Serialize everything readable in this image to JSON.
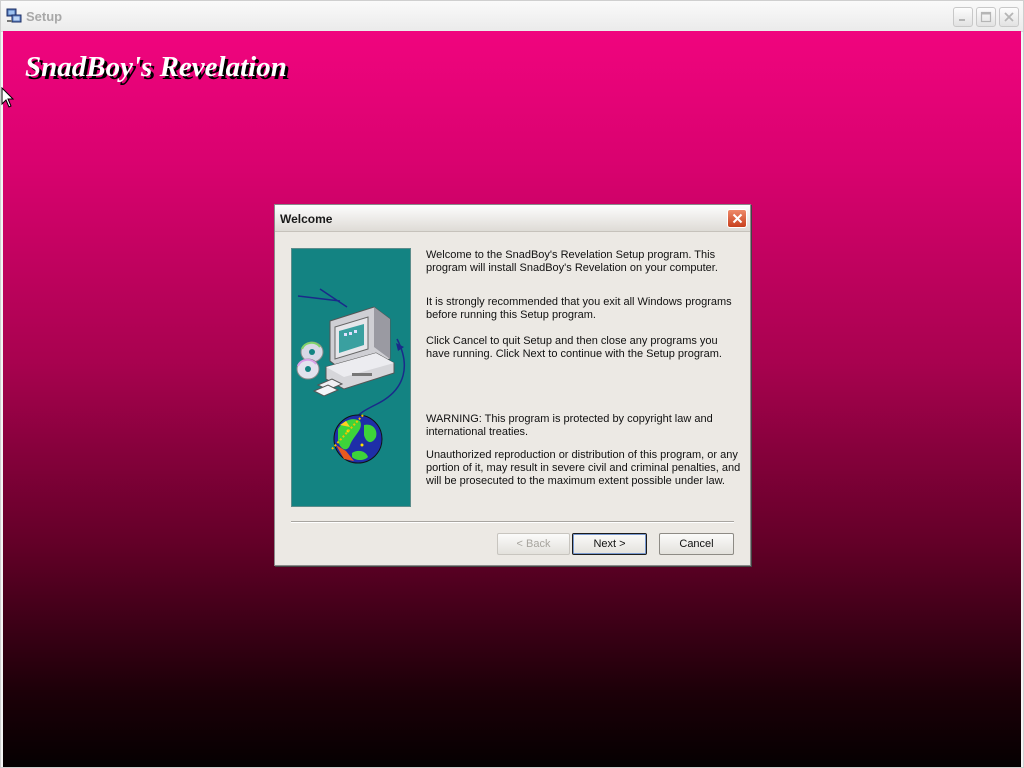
{
  "window": {
    "title": "Setup",
    "brand_title": "SnadBoy's Revelation"
  },
  "dialog": {
    "title": "Welcome",
    "paragraphs": {
      "p1": "Welcome to the SnadBoy's Revelation Setup program.  This program will install SnadBoy's Revelation on your computer.",
      "p2": "It is strongly recommended that you exit all Windows programs before running this Setup program.",
      "p3": "Click Cancel to quit Setup and then close any programs you have running.  Click Next to continue with the Setup program.",
      "p4": "WARNING: This program is protected by copyright law and international treaties.",
      "p5": "Unauthorized reproduction or distribution of this program, or any portion of it, may result in severe civil and criminal penalties, and will be prosecuted to the maximum extent possible under law."
    },
    "buttons": {
      "back": "< Back",
      "next": "Next >",
      "cancel": "Cancel"
    }
  },
  "colors": {
    "background_top": "#f0047e",
    "background_bottom": "#050001",
    "panel_teal": "#138382"
  },
  "icons": {
    "app": "setup-computer-icon",
    "minimize": "minimize-icon",
    "maximize": "maximize-icon",
    "close": "close-icon"
  }
}
